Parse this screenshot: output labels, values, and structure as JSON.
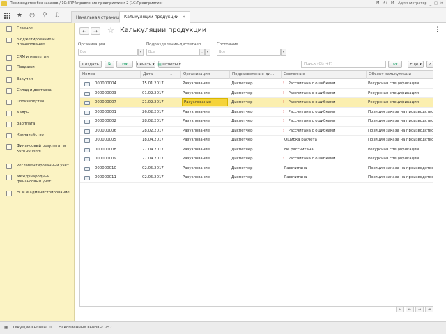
{
  "window": {
    "title": "Производство без заказов / 1С:ERP Управление предприятием 2  (1С:Предприятие)",
    "user": "Администратор",
    "controls": [
      "M",
      "M+",
      "M-"
    ]
  },
  "tabs": {
    "home": "Начальная страница",
    "calc": "Калькуляции продукции",
    "close": "×"
  },
  "sidebar": {
    "items": [
      {
        "label": "Главное",
        "icon": "home-icon"
      },
      {
        "label": "Бюджетирование и планирование",
        "icon": "budget-icon"
      },
      {
        "label": "CRM и маркетинг",
        "icon": "crm-icon"
      },
      {
        "label": "Продажи",
        "icon": "sales-icon"
      },
      {
        "label": "Закупки",
        "icon": "purchases-icon"
      },
      {
        "label": "Склад и доставка",
        "icon": "warehouse-icon"
      },
      {
        "label": "Производство",
        "icon": "production-icon"
      },
      {
        "label": "Кадры",
        "icon": "hr-icon"
      },
      {
        "label": "Зарплата",
        "icon": "salary-icon"
      },
      {
        "label": "Казначейство",
        "icon": "treasury-icon"
      },
      {
        "label": "Финансовый результат и контроллинг",
        "icon": "finance-icon"
      },
      {
        "label": "Регламентированный учет",
        "icon": "accounting-icon"
      },
      {
        "label": "Международный финансовый учет",
        "icon": "ifrs-icon"
      },
      {
        "label": "НСИ и администрирование",
        "icon": "admin-icon"
      }
    ]
  },
  "page": {
    "title": "Калькуляции продукции",
    "back": "←",
    "forward": "→",
    "star": "☆",
    "more": "⋮"
  },
  "filters": {
    "organization": {
      "label": "Организация",
      "placeholder": "Все"
    },
    "department": {
      "label": "Подразделение-диспетчер",
      "placeholder": "Все"
    },
    "state": {
      "label": "Состояние",
      "placeholder": "Все"
    }
  },
  "toolbar": {
    "create": "Создать",
    "print": "Печать",
    "reports": "Отчеты",
    "search_placeholder": "Поиск (Ctrl+F)",
    "more": "Еще",
    "help": "?"
  },
  "table": {
    "columns": [
      "Номер",
      "Дата",
      "Организация",
      "Подразделение-ди...",
      "Состояние",
      "Объект калькуляции"
    ],
    "rows": [
      {
        "number": "000000004",
        "date": "15.01.2017",
        "org": "Разузлование",
        "dept": "Диспетчер",
        "warn": true,
        "state": "Рассчитана с ошибками",
        "object": "Ресурсная спецификация"
      },
      {
        "number": "000000003",
        "date": "01.02.2017",
        "org": "Разузлование",
        "dept": "Диспетчер",
        "warn": true,
        "state": "Рассчитана с ошибками",
        "object": "Ресурсная спецификация"
      },
      {
        "number": "000000007",
        "date": "21.02.2017",
        "org": "Разузлование",
        "dept": "Диспетчер",
        "warn": true,
        "state": "Рассчитана с ошибками",
        "object": "Ресурсная спецификация",
        "selected": true
      },
      {
        "number": "000000001",
        "date": "26.02.2017",
        "org": "Разузлование",
        "dept": "Диспетчер",
        "warn": true,
        "state": "Рассчитана с ошибками",
        "object": "Позиция заказа на производство"
      },
      {
        "number": "000000002",
        "date": "28.02.2017",
        "org": "Разузлование",
        "dept": "Диспетчер",
        "warn": true,
        "state": "Рассчитана с ошибками",
        "object": "Позиция заказа на производство"
      },
      {
        "number": "000000006",
        "date": "28.02.2017",
        "org": "Разузлование",
        "dept": "Диспетчер",
        "warn": true,
        "state": "Рассчитана с ошибками",
        "object": "Позиция заказа на производство"
      },
      {
        "number": "000000005",
        "date": "18.04.2017",
        "org": "Разузлование",
        "dept": "Диспетчер",
        "warn": false,
        "state": "Ошибка расчета",
        "object": "Позиция заказа на производство"
      },
      {
        "number": "000000008",
        "date": "27.04.2017",
        "org": "Разузлование",
        "dept": "Диспетчер",
        "warn": false,
        "state": "Не рассчитана",
        "object": "Ресурсная спецификация"
      },
      {
        "number": "000000009",
        "date": "27.04.2017",
        "org": "Разузлование",
        "dept": "Диспетчер",
        "warn": true,
        "state": "Рассчитана с ошибками",
        "object": "Ресурсная спецификация"
      },
      {
        "number": "000000010",
        "date": "02.05.2017",
        "org": "Разузлование",
        "dept": "Диспетчер",
        "warn": false,
        "state": "Рассчитана",
        "object": "Позиция заказа на производство"
      },
      {
        "number": "000000011",
        "date": "02.05.2017",
        "org": "Разузлование",
        "dept": "Диспетчер",
        "warn": false,
        "state": "Рассчитана",
        "object": "Позиция заказа на производство"
      }
    ]
  },
  "status": {
    "current_calls": "Текущие вызовы: 0",
    "accumulated_calls": "Накопленные вызовы: 257"
  }
}
